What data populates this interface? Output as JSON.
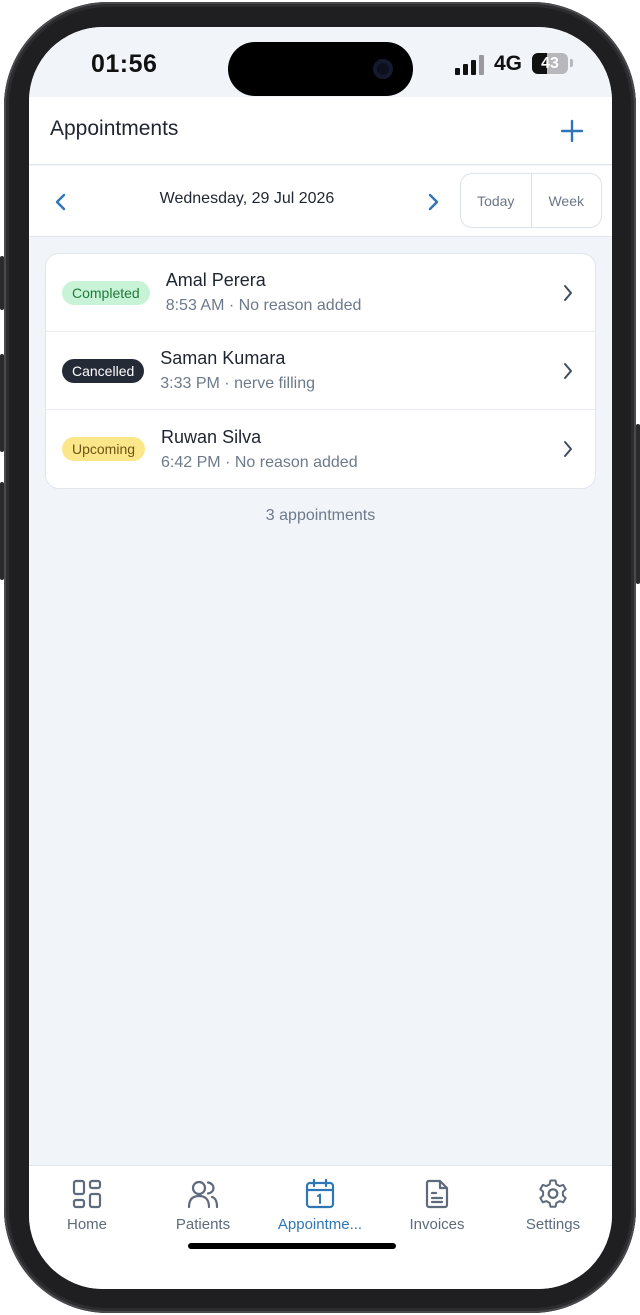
{
  "status_bar": {
    "time": "01:56",
    "network": "4G",
    "battery": "43",
    "battery_level": 0.43
  },
  "header": {
    "title": "Appointments",
    "add_icon": "plus-icon"
  },
  "date_nav": {
    "prev_icon": "chevron-left-icon",
    "date": "Wednesday, 29 Jul 2026",
    "next_icon": "chevron-right-icon",
    "today_label": "Today",
    "week_label": "Week"
  },
  "appointments": [
    {
      "status": "Completed",
      "name": "Amal Perera",
      "detail": "8:53 AM · No reason added"
    },
    {
      "status": "Cancelled",
      "name": "Saman Kumara",
      "detail": "3:33 PM · nerve filling"
    },
    {
      "status": "Upcoming",
      "name": "Ruwan Silva",
      "detail": "6:42 PM · No reason added"
    }
  ],
  "count_text": "3 appointments",
  "tabs": [
    {
      "label": "Home",
      "icon": "grid-icon"
    },
    {
      "label": "Patients",
      "icon": "users-icon"
    },
    {
      "label": "Appointme...",
      "icon": "calendar-icon",
      "active": true
    },
    {
      "label": "Invoices",
      "icon": "document-icon"
    },
    {
      "label": "Settings",
      "icon": "gear-icon"
    }
  ],
  "colors": {
    "accent": "#2f76b7",
    "background": "#f1f5fa",
    "completed_badge": "#c9f3d6",
    "cancelled_badge": "#242a36",
    "upcoming_badge": "#fbe78a"
  }
}
